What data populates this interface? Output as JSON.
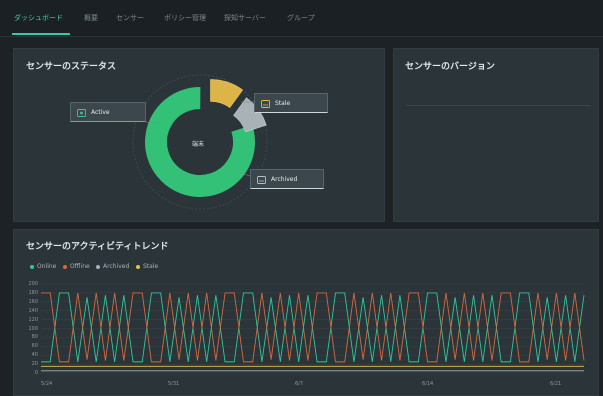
{
  "nav": {
    "tabs": [
      {
        "label": "ダッシュボード"
      },
      {
        "label": "概要"
      },
      {
        "label": "センサー"
      },
      {
        "label": "ポリシー管理"
      },
      {
        "label": "探知サーバー"
      },
      {
        "label": "グループ"
      }
    ],
    "active_tab": 0
  },
  "sensor_status": {
    "title": "センサーのステータス",
    "center_label": "端末",
    "labels": {
      "active": "Active",
      "stale": "Stale",
      "archived": "Archived"
    }
  },
  "sensor_version": {
    "title": "センサーのバージョン"
  },
  "activity": {
    "title": "センサーのアクティビティトレンド"
  },
  "colors": {
    "online": "#2fc89a",
    "offline": "#d26b3c",
    "archived": "#9eb3c3",
    "stale": "#e5c34a",
    "accent": "#36c9a6"
  },
  "chart_data": [
    {
      "type": "pie",
      "center_label": "端末",
      "categories": [
        "Active",
        "Stale",
        "Archived"
      ],
      "values": [
        80,
        10,
        10
      ]
    },
    {
      "type": "line",
      "legend_position": "top-left",
      "ylim": [
        0,
        200
      ],
      "yticks": [
        0,
        20,
        40,
        60,
        80,
        100,
        120,
        140,
        160,
        180,
        200
      ],
      "xtick_labels": [
        "5/24",
        "5/31",
        "6/7",
        "6/14",
        "6/21"
      ],
      "series": [
        {
          "name": "Online",
          "values": [
            25,
            25,
            180,
            180,
            25,
            170,
            25,
            175,
            25,
            175,
            25,
            25,
            180,
            180,
            25,
            170,
            25,
            175,
            25,
            175,
            25,
            25,
            180,
            180,
            25,
            170,
            25,
            175,
            25,
            175,
            25,
            25,
            180,
            180,
            25,
            170,
            25,
            175,
            25,
            175,
            25,
            25,
            180,
            180,
            25,
            170,
            25,
            175,
            25,
            175,
            25,
            25,
            180,
            180,
            25,
            170,
            25,
            175,
            25,
            175
          ]
        },
        {
          "name": "Offline",
          "values": [
            180,
            180,
            25,
            25,
            180,
            30,
            180,
            28,
            180,
            28,
            180,
            180,
            25,
            25,
            180,
            30,
            180,
            28,
            180,
            28,
            180,
            180,
            25,
            25,
            180,
            30,
            180,
            28,
            180,
            28,
            180,
            180,
            25,
            25,
            180,
            30,
            180,
            28,
            180,
            28,
            180,
            180,
            25,
            25,
            180,
            30,
            180,
            28,
            180,
            28,
            180,
            180,
            25,
            25,
            180,
            30,
            180,
            28,
            180,
            28
          ]
        },
        {
          "name": "Archived",
          "values": [
            5,
            5,
            5,
            5,
            5,
            5,
            5,
            5,
            5,
            5,
            5,
            5,
            5,
            5,
            5,
            5,
            5,
            5,
            5,
            5,
            5,
            5,
            5,
            5,
            5,
            5,
            5,
            5,
            5,
            5,
            5,
            5,
            5,
            5,
            5,
            5,
            5,
            5,
            5,
            5,
            5,
            5,
            5,
            5,
            5,
            5,
            5,
            5,
            5,
            5,
            5,
            5,
            5,
            5,
            5,
            5,
            5,
            5,
            5,
            5
          ]
        },
        {
          "name": "Stale",
          "values": [
            15,
            15,
            15,
            15,
            15,
            15,
            15,
            15,
            15,
            15,
            15,
            15,
            15,
            15,
            15,
            15,
            15,
            15,
            15,
            15,
            15,
            15,
            15,
            15,
            15,
            15,
            15,
            15,
            15,
            15,
            15,
            15,
            15,
            15,
            15,
            15,
            15,
            15,
            15,
            15,
            15,
            15,
            15,
            15,
            15,
            15,
            15,
            15,
            15,
            15,
            15,
            15,
            15,
            15,
            15,
            15,
            15,
            15,
            15,
            15
          ]
        }
      ]
    }
  ]
}
